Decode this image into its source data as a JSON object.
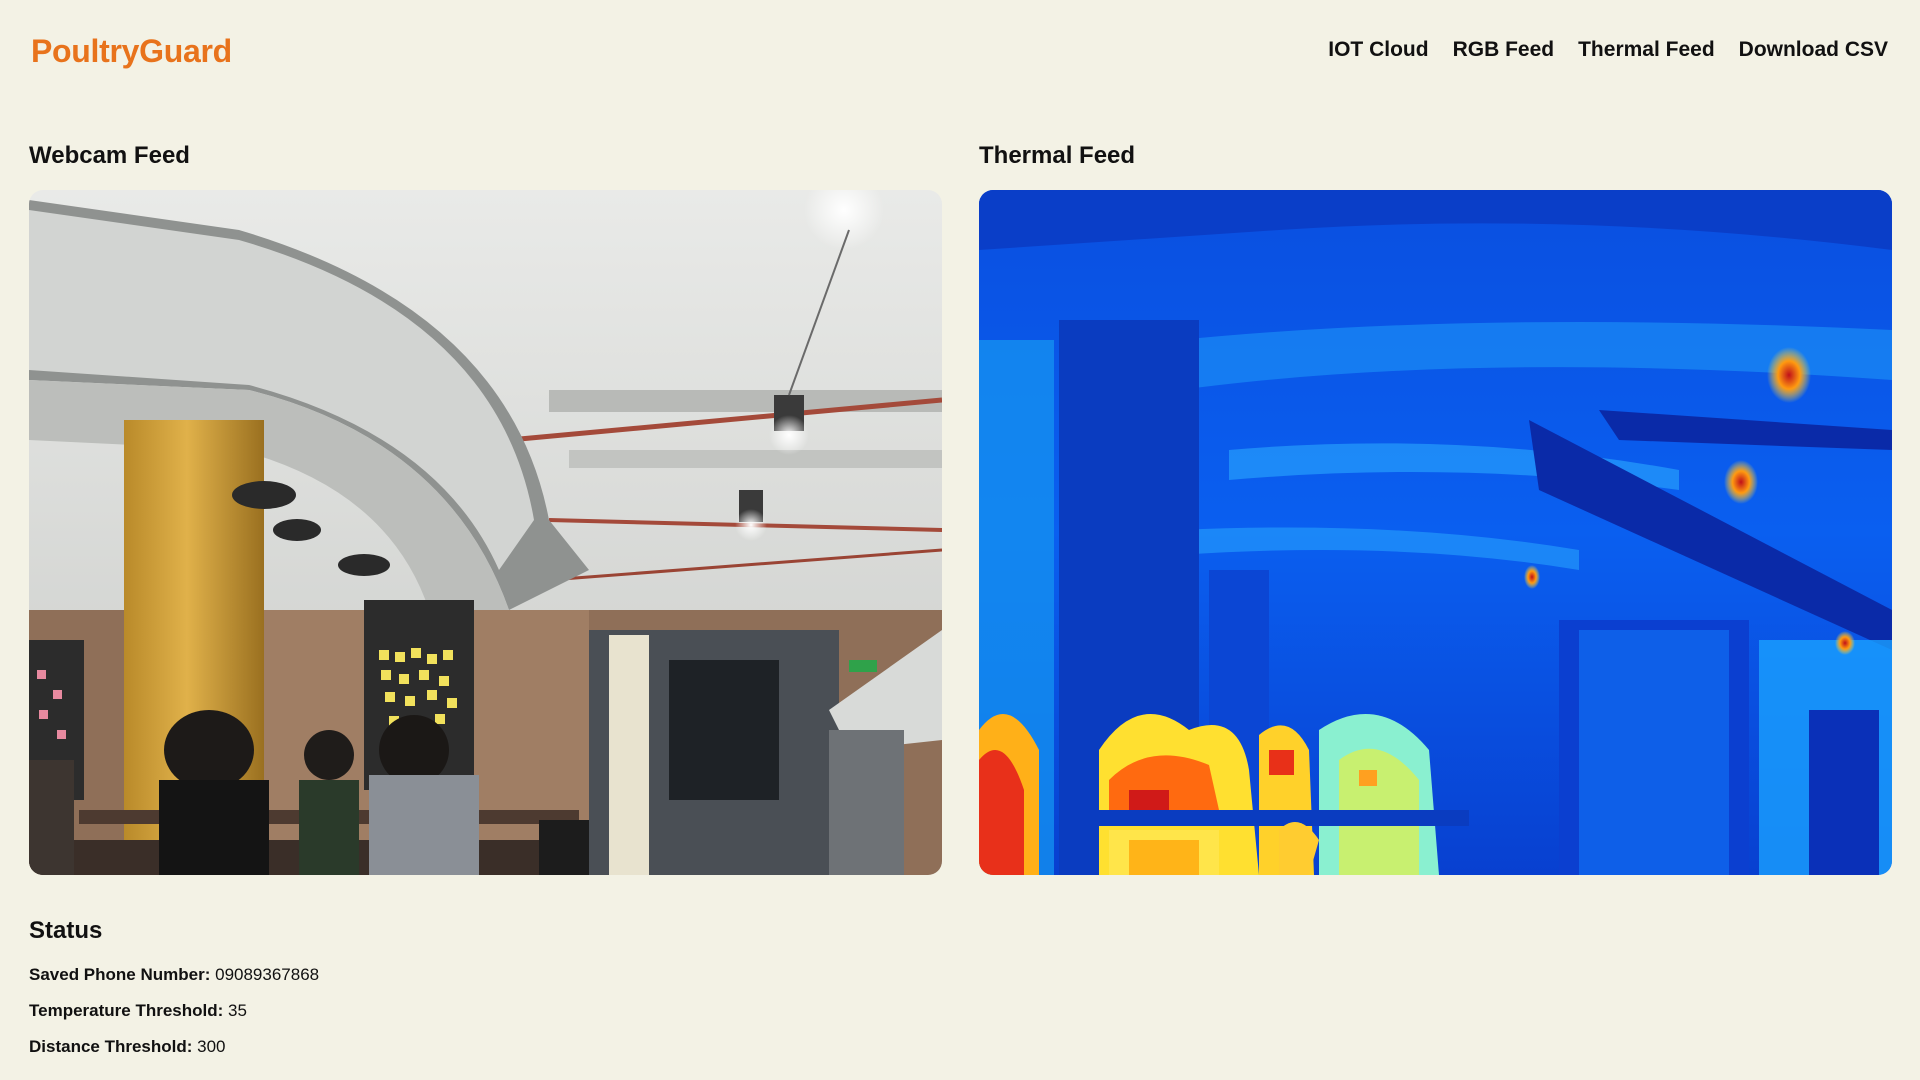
{
  "brand": {
    "name": "PoultryGuard",
    "color": "#e8731c"
  },
  "nav": {
    "items": [
      {
        "label": "IOT Cloud"
      },
      {
        "label": "RGB Feed"
      },
      {
        "label": "Thermal Feed"
      },
      {
        "label": "Download CSV"
      }
    ]
  },
  "feeds": {
    "webcam": {
      "title": "Webcam Feed"
    },
    "thermal": {
      "title": "Thermal Feed"
    }
  },
  "status": {
    "title": "Status",
    "phone": {
      "label": "Saved Phone Number:",
      "value": "09089367868"
    },
    "temperature": {
      "label": "Temperature Threshold:",
      "value": "35"
    },
    "distance": {
      "label": "Distance Threshold:",
      "value": "300"
    }
  },
  "colors": {
    "background": "#f3f2e5",
    "accent": "#e8731c",
    "text": "#111111"
  }
}
